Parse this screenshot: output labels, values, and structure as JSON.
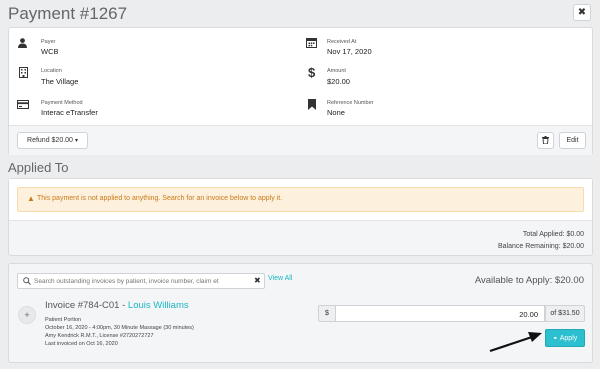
{
  "page": {
    "title": "Payment #1267"
  },
  "header": {
    "close_icon": "close-icon"
  },
  "details": {
    "payer": {
      "label": "Payer",
      "value": "WCB",
      "icon": "user-icon"
    },
    "received_at": {
      "label": "Received At",
      "value": "Nov 17, 2020",
      "icon": "calendar-icon"
    },
    "location": {
      "label": "Location",
      "value": "The Village",
      "icon": "building-icon"
    },
    "amount": {
      "label": "Amount",
      "value": "$20.00",
      "icon": "dollar-icon"
    },
    "payment_method": {
      "label": "Payment Method",
      "value": "Interac eTransfer",
      "icon": "card-icon"
    },
    "reference_number": {
      "label": "Reference Number",
      "value": "None",
      "icon": "bookmark-icon"
    }
  },
  "actions": {
    "refund_label": "Refund $20.00",
    "edit_label": "Edit",
    "delete_icon": "trash-icon"
  },
  "applied_to": {
    "heading": "Applied To",
    "warning": "This payment is not applied to anything. Search for an invoice below to apply it.",
    "total_applied": "Total Applied: $0.00",
    "balance_remaining": "Balance Remaining: $20.00"
  },
  "search": {
    "placeholder": "Search outstanding invoices by patient, invoice number, claim et",
    "view_all": "View All",
    "available": "Available to Apply: $20.00"
  },
  "invoice": {
    "number": "Invoice #784-C01",
    "separator": " - ",
    "patient": "Louis Williams",
    "portion": "Patient Portion",
    "line1": "October 16, 2020 - 4:00pm, 30 Minute Massage (30 minutes)",
    "line2": "Amy Kendrick R.M.T., License #2720272727",
    "line3": "Last invoiced on Oct 16, 2020",
    "currency": "$",
    "amount_value": "20.00",
    "of_total": "of $31.50",
    "apply_label": "Apply"
  },
  "colors": {
    "accent": "#1bb7c4",
    "warning_bg": "#fdf1de",
    "warning_text": "#c87a19",
    "apply_bg": "#2bbfcf"
  }
}
